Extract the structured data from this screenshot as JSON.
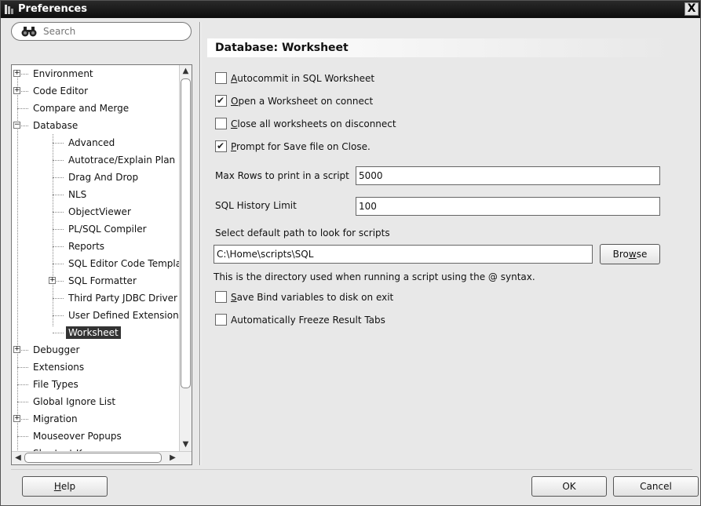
{
  "window": {
    "title": "Preferences",
    "close_label": "X"
  },
  "search": {
    "placeholder": "Search",
    "value": ""
  },
  "tree": {
    "items": [
      {
        "label": "Environment",
        "level": 0,
        "expander": "+"
      },
      {
        "label": "Code Editor",
        "level": 0,
        "expander": "+"
      },
      {
        "label": "Compare and Merge",
        "level": 0,
        "expander": ""
      },
      {
        "label": "Database",
        "level": 0,
        "expander": "-"
      },
      {
        "label": "Advanced",
        "level": 1,
        "expander": ""
      },
      {
        "label": "Autotrace/Explain Plan",
        "level": 1,
        "expander": ""
      },
      {
        "label": "Drag And Drop",
        "level": 1,
        "expander": ""
      },
      {
        "label": "NLS",
        "level": 1,
        "expander": ""
      },
      {
        "label": "ObjectViewer",
        "level": 1,
        "expander": ""
      },
      {
        "label": "PL/SQL Compiler",
        "level": 1,
        "expander": ""
      },
      {
        "label": "Reports",
        "level": 1,
        "expander": ""
      },
      {
        "label": "SQL Editor Code Templa",
        "level": 1,
        "expander": ""
      },
      {
        "label": "SQL Formatter",
        "level": 1,
        "expander": "+"
      },
      {
        "label": "Third Party JDBC Driver",
        "level": 1,
        "expander": ""
      },
      {
        "label": "User Defined Extension",
        "level": 1,
        "expander": ""
      },
      {
        "label": "Worksheet",
        "level": 1,
        "expander": "",
        "selected": true
      },
      {
        "label": "Debugger",
        "level": 0,
        "expander": "+"
      },
      {
        "label": "Extensions",
        "level": 0,
        "expander": ""
      },
      {
        "label": "File Types",
        "level": 0,
        "expander": ""
      },
      {
        "label": "Global Ignore List",
        "level": 0,
        "expander": ""
      },
      {
        "label": "Migration",
        "level": 0,
        "expander": "+"
      },
      {
        "label": "Mouseover Popups",
        "level": 0,
        "expander": ""
      },
      {
        "label": "Shortcut Keys",
        "level": 0,
        "expander": ""
      }
    ]
  },
  "page": {
    "title": "Database: Worksheet",
    "options": [
      {
        "key": "autocommit",
        "pre": "",
        "mnemonic": "A",
        "post": "utocommit in SQL Worksheet",
        "checked": false
      },
      {
        "key": "open_on_connect",
        "pre": "",
        "mnemonic": "O",
        "post": "pen a Worksheet on connect",
        "checked": true
      },
      {
        "key": "close_on_disconnect",
        "pre": "",
        "mnemonic": "C",
        "post": "lose all worksheets on disconnect",
        "checked": false
      },
      {
        "key": "prompt_save",
        "pre": "",
        "mnemonic": "P",
        "post": "rompt for Save file on Close.",
        "checked": true
      }
    ],
    "max_rows": {
      "label": "Max Rows to print in a script",
      "value": "5000"
    },
    "history": {
      "label": "SQL History Limit",
      "value": "100"
    },
    "path": {
      "label": "Select default path to look for scripts",
      "value": "C:\\Home\\scripts\\SQL",
      "browse_pre": "Bro",
      "browse_mnemonic": "w",
      "browse_post": "se"
    },
    "hint": "This is the directory used when running a script using the @ syntax.",
    "options2": [
      {
        "key": "save_bind",
        "pre": "",
        "mnemonic": "S",
        "post": "ave Bind variables to disk on exit",
        "checked": false
      },
      {
        "key": "freeze_tabs",
        "pre": "Automatically Freeze Result Tabs",
        "mnemonic": "",
        "post": "",
        "checked": false
      }
    ]
  },
  "footer": {
    "help_mnemonic": "H",
    "help_rest": "elp",
    "ok_label": "OK",
    "cancel_label": "Cancel"
  },
  "checkmark": "✔"
}
